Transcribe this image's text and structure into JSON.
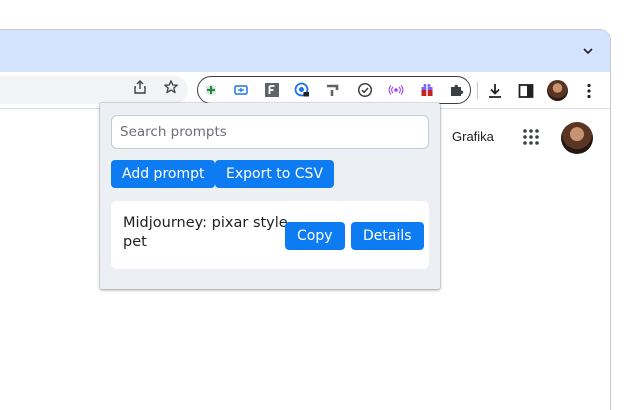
{
  "browser": {
    "tab_menu_icon": "chevron-down-icon",
    "toolbar_icons": [
      "share-icon",
      "bookmark-star-icon",
      "download-icon",
      "side-panel-icon",
      "kebab-menu-icon"
    ],
    "extension_icons": [
      "gem-plus-icon",
      "tag-icon",
      "f-letter-icon",
      "lock-badge-icon",
      "seven-shape-icon",
      "check-circle-icon",
      "radio-waves-icon",
      "gift-box-icon",
      "puzzle-icon"
    ],
    "accent_color": "#0d7cf2",
    "tabstrip_color": "#d3e3fd"
  },
  "page": {
    "account_name": "Grafika",
    "apps_icon": "apps-grid-icon"
  },
  "popup": {
    "search": {
      "placeholder": "Search prompts",
      "value": ""
    },
    "actions": {
      "add_label": "Add prompt",
      "export_label": "Export to CSV"
    },
    "prompts": [
      {
        "title": "Midjourney: pixar style pet",
        "copy_label": "Copy",
        "details_label": "Details"
      }
    ]
  }
}
